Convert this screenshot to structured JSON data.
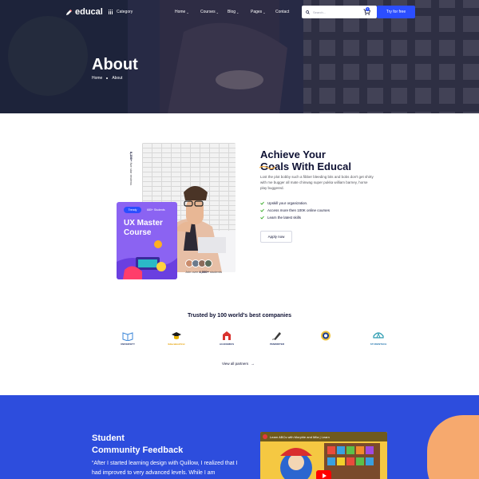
{
  "header": {
    "logo": "educal",
    "category_label": "Category",
    "menu": [
      {
        "label": "Home",
        "has_dropdown": true
      },
      {
        "label": "Courses",
        "has_dropdown": true
      },
      {
        "label": "Blog",
        "has_dropdown": true
      },
      {
        "label": "Pages",
        "has_dropdown": true
      },
      {
        "label": "Contact",
        "has_dropdown": false
      }
    ],
    "search_placeholder": "Search...",
    "cart_count": "2",
    "cta_label": "Try for free",
    "accent_color": "#2b4eff"
  },
  "hero": {
    "title": "About",
    "breadcrumb": [
      "Home",
      "About"
    ]
  },
  "about": {
    "vertical_count": "8,200+",
    "vertical_text": "five star reviews",
    "card": {
      "badge": "Trendy",
      "students": "680+ Students",
      "title": "UX Master Course"
    },
    "join_prefix": "Join over",
    "join_count": "4,000+",
    "join_suffix": "students",
    "title_line1": "Achieve Your",
    "title_line2": "Goals With Educal",
    "description": "Lost the plot bobby such a fibber bleeding bits and bobs don't get shirty with me bugger all mate chinwag super pukka william barney, horse play buggered.",
    "checklist": [
      "Upskill your organization.",
      "Access more then 100K online courses",
      "Learn the latest skills"
    ],
    "apply_label": "Apply now"
  },
  "trusted": {
    "title": "Trusted by 100 world's best companies",
    "brands": [
      {
        "name": "UNIVERSITY",
        "icon": "book-icon"
      },
      {
        "name": "EducationFirst",
        "icon": "graduation-cap-icon"
      },
      {
        "name": "ACADEMICS",
        "icon": "academic-building-icon"
      },
      {
        "name": "PENWRITER",
        "icon": "pen-nib-icon"
      },
      {
        "name": "",
        "icon": "seal-icon"
      },
      {
        "name": "STUDENTECH",
        "icon": "student-tech-icon"
      }
    ],
    "view_all_label": "View all partners"
  },
  "feedback": {
    "title_line1": "Student",
    "title_line2": "Community Feedback",
    "quote": "“After I started learning design with Quillow, I realized that I had improved to very advanced levels. While I am",
    "video_title": "Learn ABCs with Morphle and Mila | Learn"
  },
  "colors": {
    "primary": "#2b4eff",
    "heading": "#0e1133",
    "feedback_bg": "#2d4ddd",
    "card_purple": "#8b63f2",
    "check_green": "#30a820"
  }
}
